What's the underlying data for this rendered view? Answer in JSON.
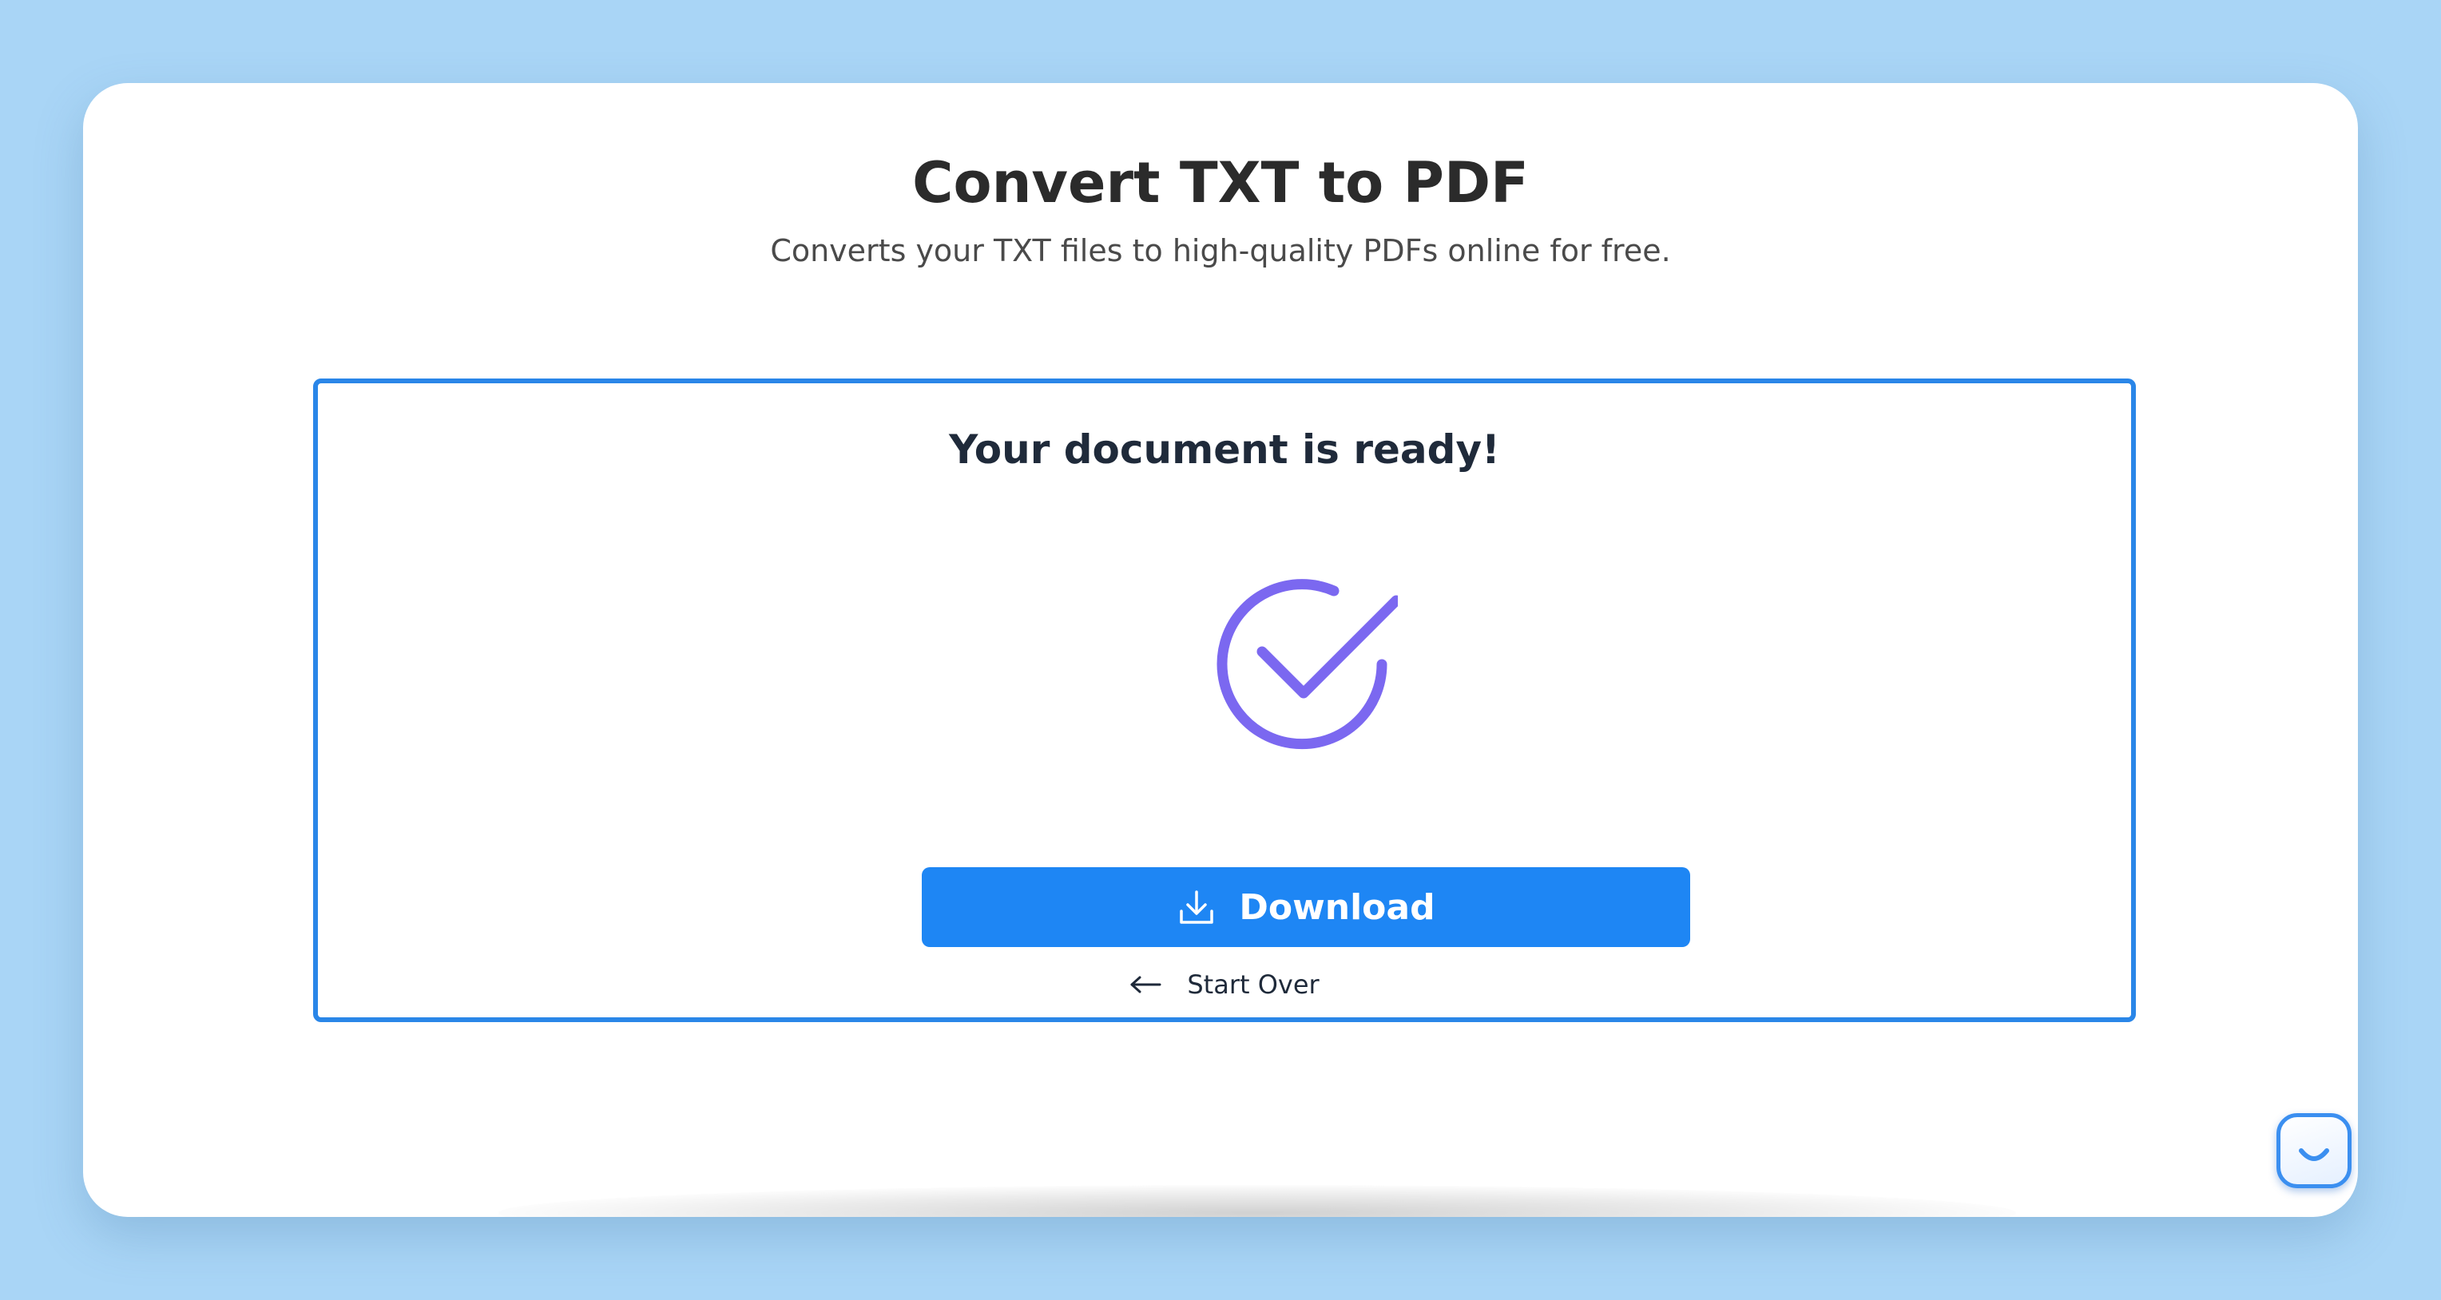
{
  "header": {
    "title": "Convert TXT to PDF",
    "subtitle": "Converts your TXT files to high-quality PDFs online for free."
  },
  "result": {
    "heading": "Your document is ready!",
    "status_icon": "check-circle-icon",
    "download_label": "Download",
    "download_icon": "download-icon",
    "start_over_label": "Start Over",
    "start_over_icon": "arrow-left-icon"
  },
  "chat_widget": {
    "icon": "smile-icon"
  },
  "colors": {
    "background": "#a9d5f6",
    "accent": "#1e86f4",
    "box_border": "#2a86e8",
    "check": "#7b68f0"
  }
}
